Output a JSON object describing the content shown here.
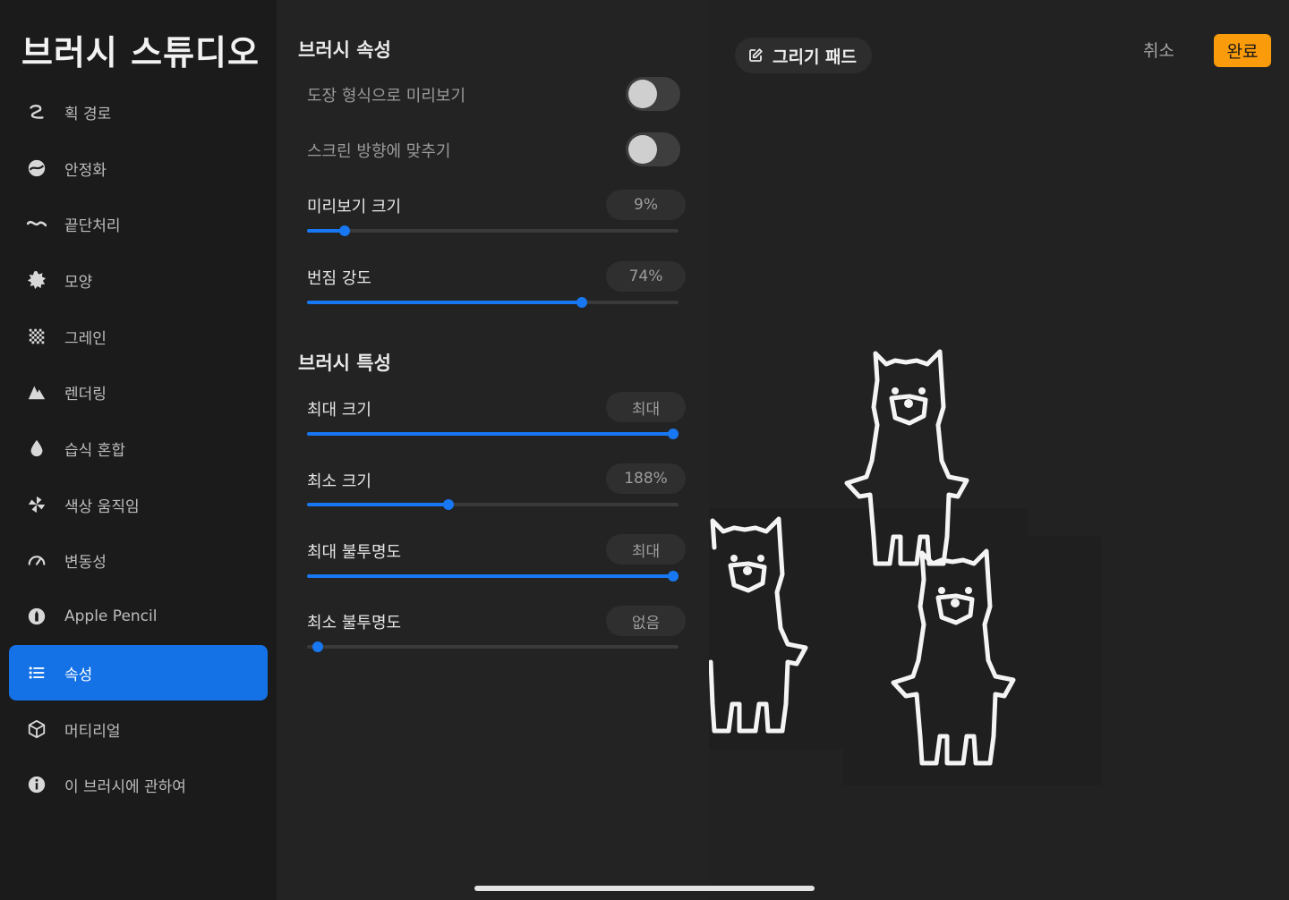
{
  "app": {
    "title": "브러시 스튜디오"
  },
  "sidebar": {
    "items": [
      {
        "label": "획 경로",
        "icon": "stroke-path-icon"
      },
      {
        "label": "안정화",
        "icon": "stabilization-icon"
      },
      {
        "label": "끝단처리",
        "icon": "taper-icon"
      },
      {
        "label": "모양",
        "icon": "shape-icon"
      },
      {
        "label": "그레인",
        "icon": "grain-icon"
      },
      {
        "label": "렌더링",
        "icon": "rendering-icon"
      },
      {
        "label": "습식 혼합",
        "icon": "wet-mix-icon"
      },
      {
        "label": "색상 움직임",
        "icon": "color-dynamics-icon"
      },
      {
        "label": "변동성",
        "icon": "dynamics-icon"
      },
      {
        "label": "Apple Pencil",
        "icon": "apple-pencil-icon"
      },
      {
        "label": "속성",
        "icon": "properties-icon",
        "active": true
      },
      {
        "label": "머티리얼",
        "icon": "materials-icon"
      },
      {
        "label": "이 브러시에 관하여",
        "icon": "info-icon"
      }
    ]
  },
  "properties": {
    "section_brush_props": "브러시 속성",
    "toggles": [
      {
        "label": "도장 형식으로 미리보기",
        "on": false
      },
      {
        "label": "스크린 방향에 맞추기",
        "on": false
      }
    ],
    "sliders_top": [
      {
        "label": "미리보기 크기",
        "value": "9%",
        "level": 0.1
      },
      {
        "label": "번짐 강도",
        "value": "74%",
        "level": 0.74
      }
    ],
    "section_brush_behavior": "브러시 특성",
    "sliders_bottom": [
      {
        "label": "최대 크기",
        "value": "최대",
        "level": 1.0
      },
      {
        "label": "최소 크기",
        "value": "188%",
        "level": 0.38
      },
      {
        "label": "최대 불투명도",
        "value": "최대",
        "level": 1.0
      },
      {
        "label": "최소 불투명도",
        "value": "없음",
        "level": 0.0
      }
    ]
  },
  "pad": {
    "drawing_pad_label": "그리기 패드",
    "cancel_label": "취소",
    "done_label": "완료"
  },
  "colors": {
    "accent": "#1877f2",
    "active_item": "#1472e6",
    "done": "#f99b0b"
  }
}
